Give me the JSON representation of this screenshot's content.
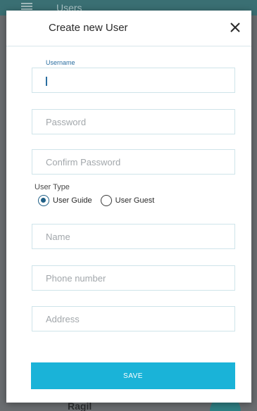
{
  "background": {
    "appbar_title": "Users",
    "list_item_name": "Ragil"
  },
  "dialog": {
    "title": "Create new User",
    "close_icon": "close-icon",
    "fields": {
      "username": {
        "label": "Username",
        "value": "",
        "placeholder": ""
      },
      "password": {
        "placeholder": "Password"
      },
      "confirm_password": {
        "placeholder": "Confirm Password"
      },
      "name": {
        "placeholder": "Name"
      },
      "phone": {
        "placeholder": "Phone number"
      },
      "address": {
        "placeholder": "Address"
      }
    },
    "user_type": {
      "label": "User Type",
      "options": [
        {
          "label": "User Guide",
          "selected": true
        },
        {
          "label": "User Guest",
          "selected": false
        }
      ]
    },
    "save_label": "SAVE"
  },
  "colors": {
    "accent": "#1ab3d8",
    "radio_selected": "#1f5f86",
    "field_border": "#cfe4ea",
    "appbar": "#3a6f73"
  }
}
